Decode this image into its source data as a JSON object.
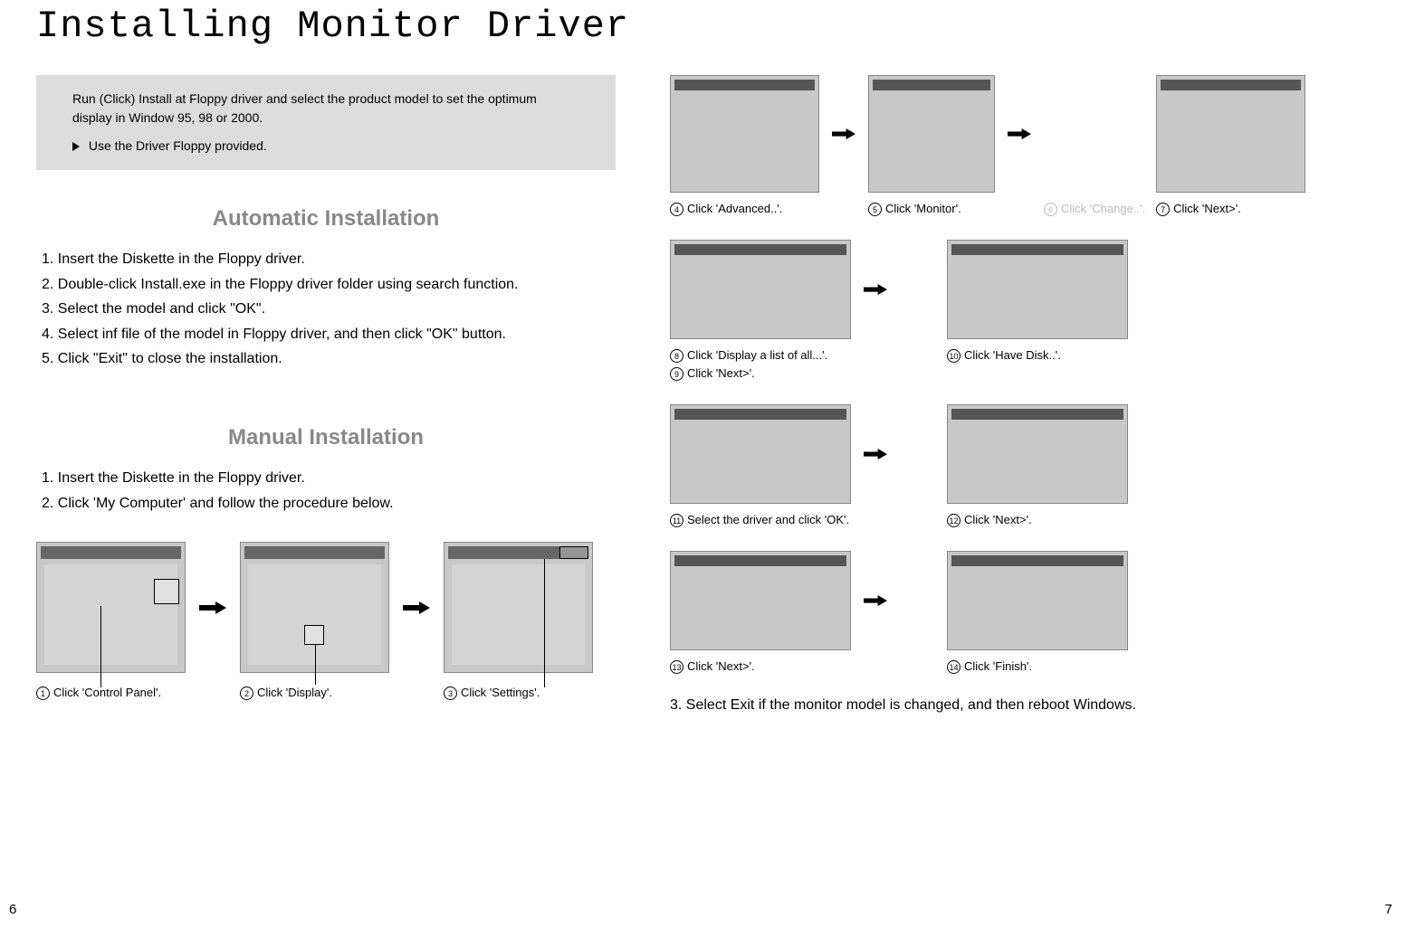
{
  "page_title": "Installing Monitor Driver",
  "callout": {
    "text": "Run (Click) Install at Floppy driver and select the product model to set the optimum display in Window 95, 98 or 2000.",
    "note": "Use the Driver Floppy provided."
  },
  "automatic": {
    "heading": "Automatic Installation",
    "steps": [
      "1. Insert the Diskette in the Floppy driver.",
      "2. Double-click Install.exe in the Floppy driver folder using search function.",
      "3. Select the model and click \"OK\".",
      "4. Select inf file of the model in Floppy driver, and then click \"OK\" button.",
      "5. Click \"Exit\" to close the installation."
    ]
  },
  "manual": {
    "heading": "Manual Installation",
    "steps": [
      "1. Insert the Diskette in the Floppy driver.",
      "2. Click 'My Computer' and follow the procedure below."
    ]
  },
  "captions": {
    "c1": "Click 'Control Panel'.",
    "c2": "Click 'Display'.",
    "c3": "Click 'Settings'.",
    "c4": "Click 'Advanced..'.",
    "c5": "Click 'Monitor'.",
    "c6": "Click 'Change..'.",
    "c7": "Click 'Next>'.",
    "c8": "Click 'Display a list of all...'.",
    "c9": "Click 'Next>'.",
    "c10": "Click 'Have Disk..'.",
    "c11": "Select the driver and click 'OK'.",
    "c12": "Click 'Next>'.",
    "c13": "Click 'Next>'.",
    "c14": "Click 'Finish'."
  },
  "final_step": "3. Select Exit if the monitor model is changed, and then reboot Windows.",
  "page_numbers": {
    "left": "6",
    "right": "7"
  }
}
